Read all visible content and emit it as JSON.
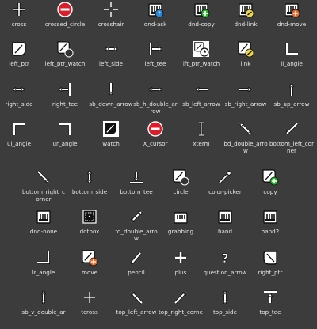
{
  "colors": {
    "background": "#3c3c3c",
    "label": "#e6e6e6",
    "red": "#d8202c",
    "green": "#2fb62f",
    "blue": "#2b86d8",
    "yellow": "#e9d64a",
    "orange": "#e36b2c"
  },
  "rows": [
    [
      {
        "label": "cross",
        "icon": "cross-icon"
      },
      {
        "label": "crossed_circle",
        "icon": "crossed-circle-icon"
      },
      {
        "label": "crosshair",
        "icon": "crosshair-icon"
      },
      {
        "label": "dnd-ask",
        "icon": "dnd-ask-icon"
      },
      {
        "label": "dnd-copy",
        "icon": "dnd-copy-icon"
      },
      {
        "label": "dnd-link",
        "icon": "dnd-link-icon"
      },
      {
        "label": "dnd-move",
        "icon": "dnd-move-icon"
      }
    ],
    [
      {
        "label": "left_ptr",
        "icon": "left-ptr-icon"
      },
      {
        "label": "left_ptr_watch",
        "icon": "left-ptr-watch-icon"
      },
      {
        "label": "left_side",
        "icon": "left-side-icon"
      },
      {
        "label": "left_tee",
        "icon": "left-tee-icon"
      },
      {
        "label": "lft_ptr_watch",
        "icon": "lft-ptr-watch-icon"
      },
      {
        "label": "link",
        "icon": "link-icon"
      },
      {
        "label": "ll_angle",
        "icon": "ll-angle-icon"
      }
    ],
    [
      {
        "label": "right_side",
        "icon": "right-side-icon"
      },
      {
        "label": "right_tee",
        "icon": "right-tee-icon"
      },
      {
        "label": "sb_down_arrow",
        "icon": "sb-down-arrow-icon"
      },
      {
        "label": "sb_h_double_ar row",
        "icon": "sb-h-double-arrow-icon"
      },
      {
        "label": "sb_left_arrow",
        "icon": "sb-left-arrow-icon"
      },
      {
        "label": "sb_right_arrow",
        "icon": "sb-right-arrow-icon"
      },
      {
        "label": "sb_up_arrow",
        "icon": "sb-up-arrow-icon"
      }
    ],
    [
      {
        "label": "ul_angle",
        "icon": "ul-angle-icon"
      },
      {
        "label": "ur_angle",
        "icon": "ur-angle-icon"
      },
      {
        "label": "watch",
        "icon": "watch-icon"
      },
      {
        "label": "X_cursor",
        "icon": "x-cursor-icon"
      },
      {
        "label": "xterm",
        "icon": "xterm-icon"
      },
      {
        "label": "bd_double_arro w",
        "icon": "bd-double-arrow-icon"
      },
      {
        "label": "bottom_left_cor ner",
        "icon": "bottom-left-corner-icon"
      }
    ],
    [
      {
        "label": "bottom_right_c orner",
        "icon": "bottom-right-corner-icon"
      },
      {
        "label": "bottom_side",
        "icon": "bottom-side-icon"
      },
      {
        "label": "bottom_tee",
        "icon": "bottom-tee-icon"
      },
      {
        "label": "circle",
        "icon": "circle-icon"
      },
      {
        "label": "color-picker",
        "icon": "color-picker-icon"
      },
      {
        "label": "copy",
        "icon": "copy-icon"
      }
    ],
    [
      {
        "label": "dnd-none",
        "icon": "dnd-none-icon"
      },
      {
        "label": "dotbox",
        "icon": "dotbox-icon"
      },
      {
        "label": "fd_double_arro w",
        "icon": "fd-double-arrow-icon"
      },
      {
        "label": "grabbing",
        "icon": "grabbing-icon"
      },
      {
        "label": "hand",
        "icon": "hand-icon"
      },
      {
        "label": "hand2",
        "icon": "hand2-icon"
      }
    ],
    [
      {
        "label": "lr_angle",
        "icon": "lr-angle-icon"
      },
      {
        "label": "move",
        "icon": "move-icon"
      },
      {
        "label": "pencil",
        "icon": "pencil-icon"
      },
      {
        "label": "plus",
        "icon": "plus-icon"
      },
      {
        "label": "question_arrow",
        "icon": "question-arrow-icon"
      },
      {
        "label": "right_ptr",
        "icon": "right-ptr-icon"
      }
    ],
    [
      {
        "label": "sb_v_double_ar",
        "icon": "sb-v-double-arrow-icon"
      },
      {
        "label": "tcross",
        "icon": "tcross-icon"
      },
      {
        "label": "top_left_arrow",
        "icon": "top-left-arrow-icon"
      },
      {
        "label": "top_right_corne",
        "icon": "top-right-corner-icon"
      },
      {
        "label": "top_side",
        "icon": "top-side-icon"
      },
      {
        "label": "top_tee",
        "icon": "top-tee-icon"
      }
    ]
  ]
}
